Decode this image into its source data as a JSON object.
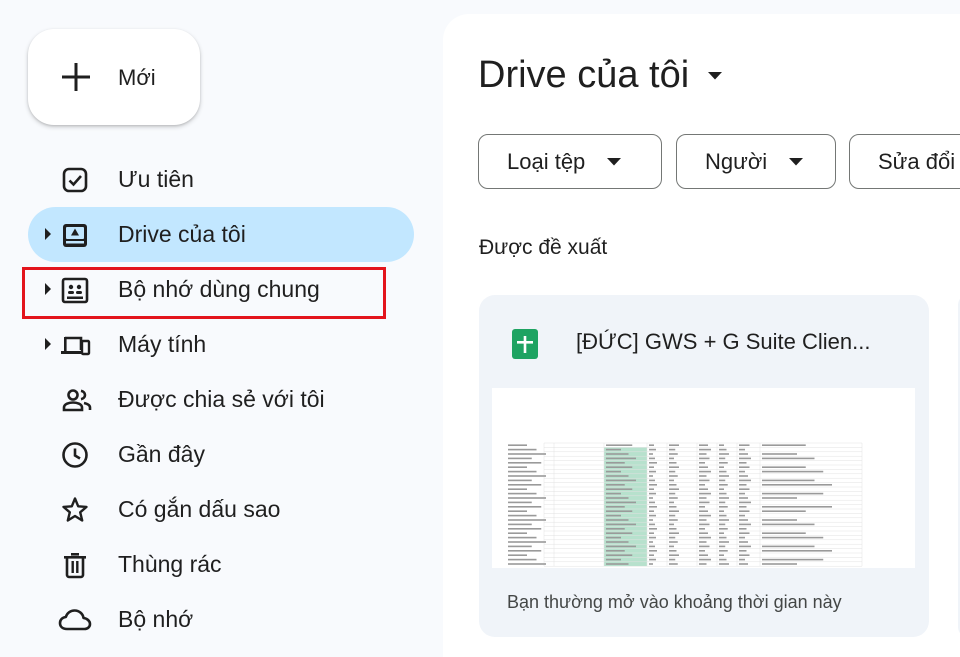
{
  "sidebar": {
    "new_button": {
      "label": "Mới"
    },
    "items": [
      {
        "label": "Ưu tiên",
        "icon": "priority-check-icon",
        "has_caret": false,
        "active": false
      },
      {
        "label": "Drive của tôi",
        "icon": "my-drive-icon",
        "has_caret": true,
        "active": true
      },
      {
        "label": "Bộ nhớ dùng chung",
        "icon": "shared-drives-icon",
        "has_caret": true,
        "active": false
      },
      {
        "label": "Máy tính",
        "icon": "computers-icon",
        "has_caret": true,
        "active": false
      },
      {
        "label": "Được chia sẻ với tôi",
        "icon": "shared-with-me-icon",
        "has_caret": false,
        "active": false
      },
      {
        "label": "Gần đây",
        "icon": "clock-icon",
        "has_caret": false,
        "active": false
      },
      {
        "label": "Có gắn dấu sao",
        "icon": "star-icon",
        "has_caret": false,
        "active": false
      },
      {
        "label": "Thùng rác",
        "icon": "trash-icon",
        "has_caret": false,
        "active": false
      },
      {
        "label": "Bộ nhớ",
        "icon": "cloud-icon",
        "has_caret": false,
        "active": false
      }
    ],
    "highlighted_item": "Bộ nhớ dùng chung"
  },
  "main": {
    "title": "Drive của tôi",
    "filters": [
      {
        "label": "Loại tệp"
      },
      {
        "label": "Người"
      },
      {
        "label": "Sửa đổi"
      }
    ],
    "suggested_label": "Được đề xuất",
    "suggested_file": {
      "name": "[ĐỨC] GWS + G Suite Clien...",
      "subtitle": "Bạn thường mở vào khoảng thời gian này",
      "icon": "google-sheets-icon"
    }
  },
  "colors": {
    "active_nav": "#c2e7ff",
    "highlight_border": "#e3141c",
    "sheets_green": "#1ea362",
    "page_bg": "#f8fafd"
  }
}
